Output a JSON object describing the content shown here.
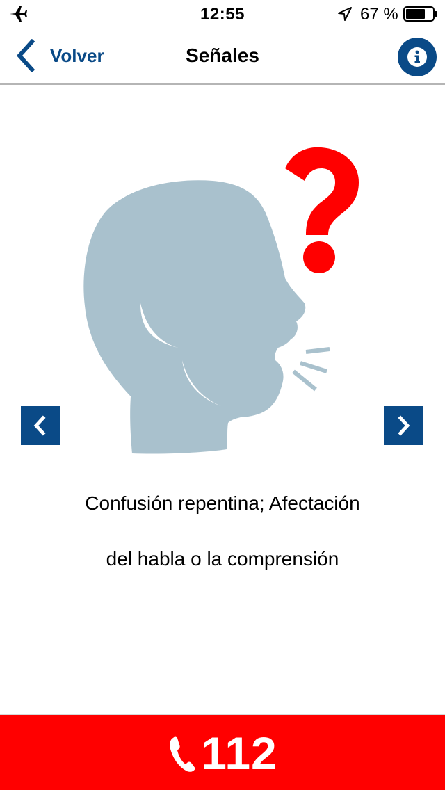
{
  "status_bar": {
    "time": "12:55",
    "battery_percent": "67 %",
    "icons": [
      "airplane-icon",
      "location-icon",
      "battery-icon"
    ]
  },
  "nav": {
    "back_label": "Volver",
    "title": "Señales",
    "info_icon": "info-icon"
  },
  "illustration": {
    "description_icon": "confused-speaking-head-icon",
    "colors": {
      "head": "#a9c1cd",
      "question_mark": "#ff0000"
    }
  },
  "carousel": {
    "prev_icon": "chevron-left-icon",
    "next_icon": "chevron-right-icon"
  },
  "caption": {
    "line1": "Confusión repentina; Afectación",
    "line2": "del habla o la comprensión"
  },
  "emergency": {
    "number": "112",
    "icon": "phone-icon",
    "color": "#ff0000"
  },
  "colors": {
    "accent": "#0a4a87",
    "divider": "#b5b5b5"
  }
}
